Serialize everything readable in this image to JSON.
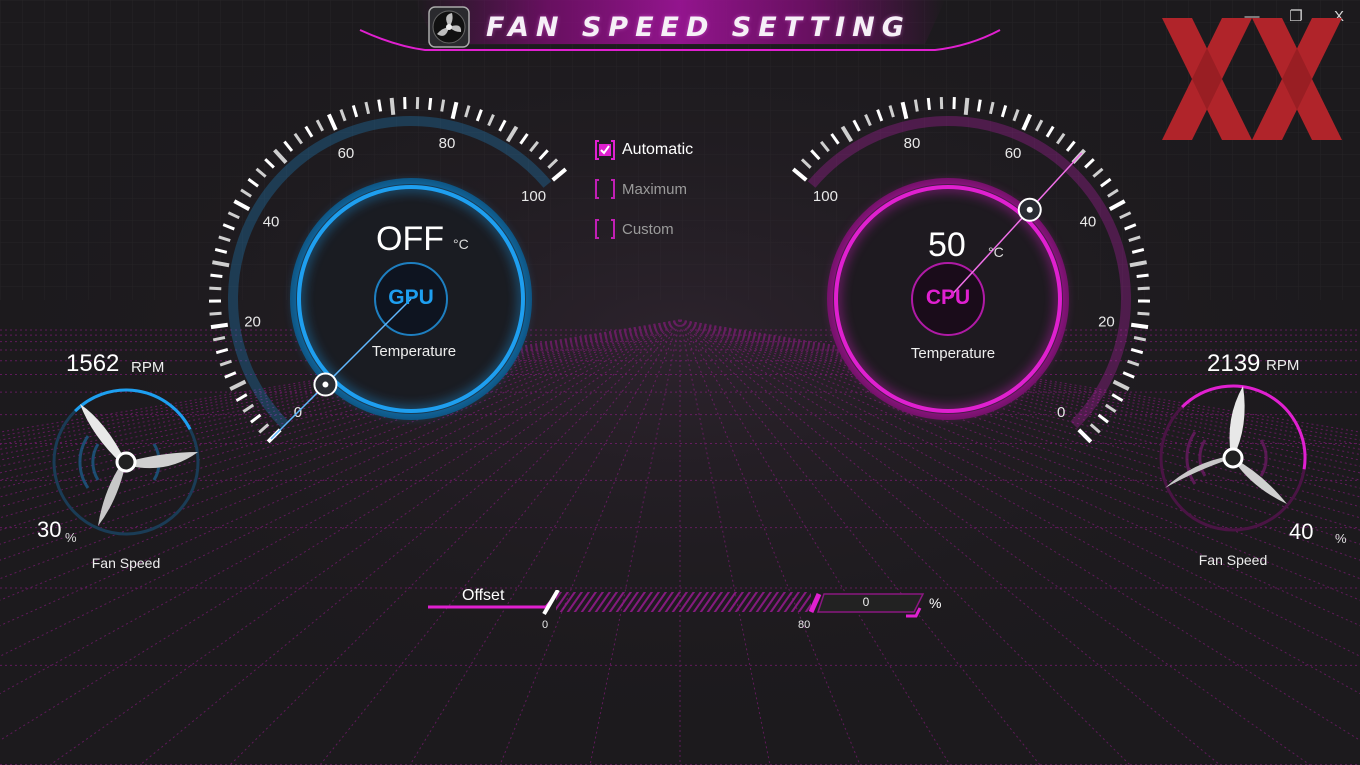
{
  "app": {
    "title": "FAN SPEED SETTING"
  },
  "window_controls": {
    "minimize": "—",
    "restore": "❐",
    "close": "X"
  },
  "gpu": {
    "chip_label": "GPU",
    "temperature_value": "OFF",
    "temperature_unit": "°C",
    "temperature_label": "Temperature",
    "gauge_ticks": [
      "0",
      "20",
      "40",
      "60",
      "80",
      "100"
    ],
    "needle_value": 0,
    "accent_color": "#1e9ff0"
  },
  "cpu": {
    "chip_label": "CPU",
    "temperature_value": "50",
    "temperature_unit": "°C",
    "temperature_label": "Temperature",
    "gauge_ticks": [
      "0",
      "20",
      "40",
      "60",
      "80",
      "100"
    ],
    "needle_value": 50,
    "accent_color": "#e020d0"
  },
  "fan_left": {
    "rpm": "1562",
    "rpm_unit": "RPM",
    "percent": "30",
    "percent_unit": "%",
    "label": "Fan Speed",
    "fill_fraction": 0.3,
    "icon": "fan-icon"
  },
  "fan_right": {
    "rpm": "2139",
    "rpm_unit": "RPM",
    "percent": "40",
    "percent_unit": "%",
    "label": "Fan Speed",
    "fill_fraction": 0.4,
    "icon": "fan-icon"
  },
  "modes": [
    {
      "label": "Automatic",
      "checked": true
    },
    {
      "label": "Maximum",
      "checked": false
    },
    {
      "label": "Custom",
      "checked": false
    }
  ],
  "offset": {
    "label": "Offset",
    "min_label": "0",
    "max_label": "80",
    "value": "0",
    "unit": "%"
  },
  "colors": {
    "background": "#1c1a1d",
    "magenta": "#e020d0",
    "blue": "#1e9ff0",
    "logo_red": "#b0242a"
  }
}
